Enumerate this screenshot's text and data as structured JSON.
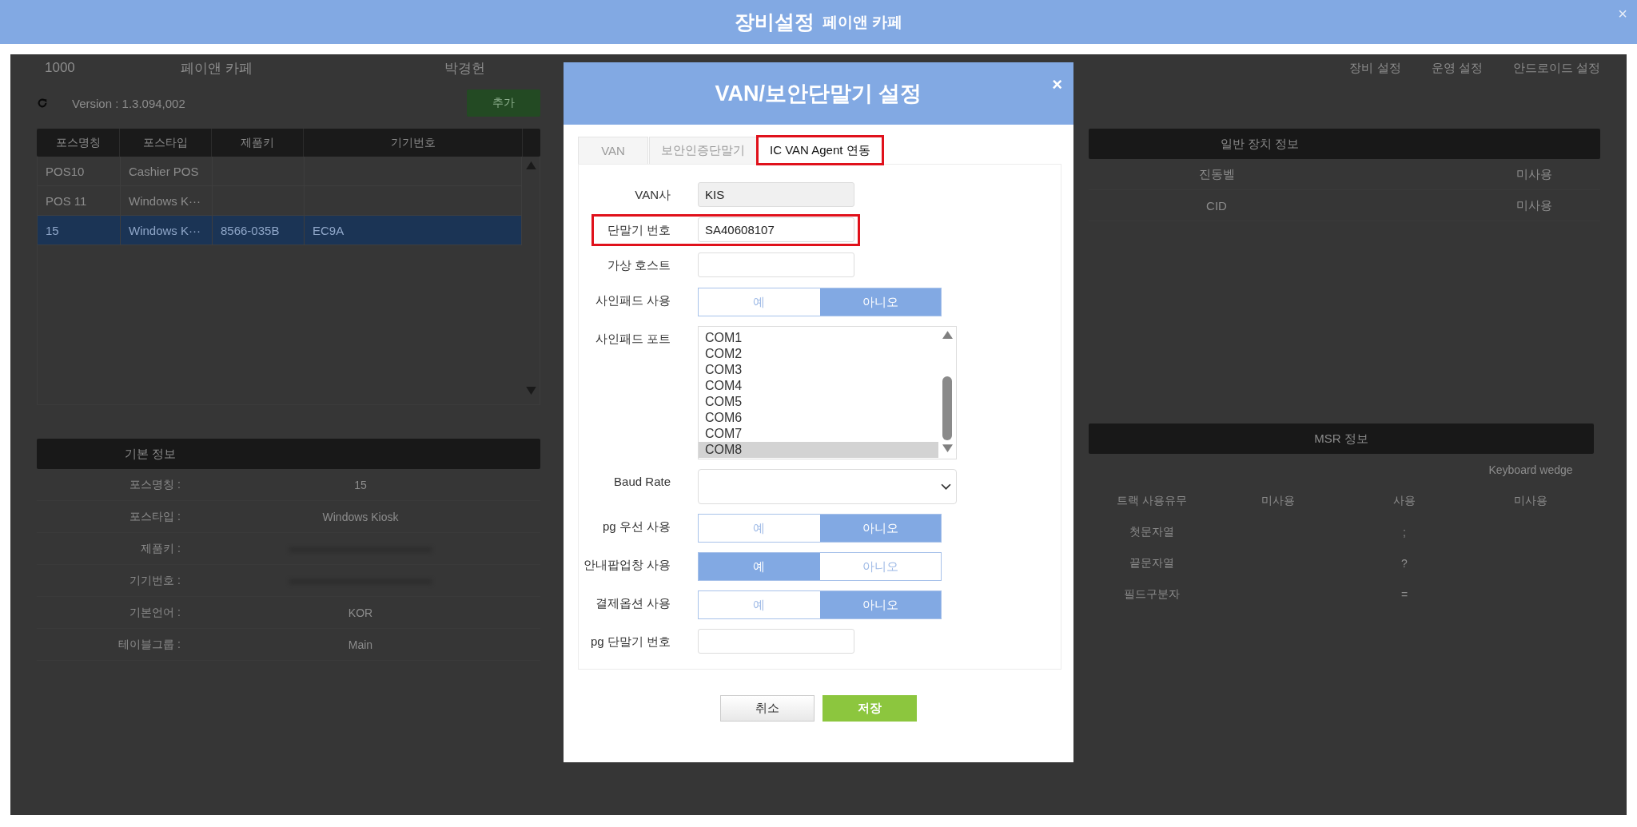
{
  "window": {
    "title": "장비설정",
    "subtitle": "페이앤 카페",
    "close": "×"
  },
  "store_bar": {
    "code": "1000",
    "name": "페이앤 카페",
    "owner": "박경헌",
    "links": [
      "장비 설정",
      "운영 설정",
      "안드로이드 설정"
    ]
  },
  "toolbar": {
    "version": "Version : 1.3.094,002",
    "add_button": "추가"
  },
  "pos_table": {
    "columns": [
      "포스명칭",
      "포스타입",
      "제품키",
      "기기번호"
    ],
    "rows": [
      {
        "cells": [
          "POS10",
          "Cashier POS",
          "",
          ""
        ],
        "selected": false
      },
      {
        "cells": [
          "POS 11",
          "Windows K···",
          "",
          ""
        ],
        "selected": false
      },
      {
        "cells": [
          "15",
          "Windows K···",
          "8566-035B",
          "EC9A"
        ],
        "selected": true
      }
    ]
  },
  "general_devices": {
    "title": "일반 장치 정보",
    "rows": [
      {
        "name": "진동벨",
        "value": "미사용"
      },
      {
        "name": "CID",
        "value": "미사용"
      }
    ]
  },
  "basic_info": {
    "title": "기본 정보",
    "rows": [
      {
        "label": "포스명칭 :",
        "value": "15"
      },
      {
        "label": "포스타입 :",
        "value": "Windows Kiosk"
      },
      {
        "label": "제품키 :",
        "blurred": true
      },
      {
        "label": "기기번호 :",
        "blurred": true
      },
      {
        "label": "기본언어 :",
        "value": "KOR"
      },
      {
        "label": "테이블그룹 :",
        "value": "Main"
      }
    ]
  },
  "msr_info": {
    "title": "MSR 정보",
    "mode": "Keyboard wedge",
    "track_row": [
      "트랙 사용유무",
      "미사용",
      "사용",
      "미사용"
    ],
    "rows": [
      {
        "label": "첫문자열",
        "value": ";"
      },
      {
        "label": "끝문자열",
        "value": "?"
      },
      {
        "label": "필드구분자",
        "value": "="
      }
    ]
  },
  "dialog": {
    "title": "VAN/보안단말기 설정",
    "close": "×",
    "tabs": [
      {
        "label": "VAN",
        "selected": false,
        "highlighted": false
      },
      {
        "label": "보안인증단말기",
        "selected": false,
        "highlighted": false
      },
      {
        "label": "IC VAN Agent 연동",
        "selected": true,
        "highlighted": true
      }
    ],
    "fields": [
      {
        "kind": "readonly",
        "label": "VAN사",
        "value": "KIS",
        "highlighted": false
      },
      {
        "kind": "text",
        "label": "단말기 번호",
        "value": "SA40608107",
        "highlighted": true
      },
      {
        "kind": "text",
        "label": "가상 호스트",
        "highlighted": false
      },
      {
        "kind": "toggle",
        "label": "사인패드 사용",
        "options": [
          {
            "label": "예",
            "selected": false
          },
          {
            "label": "아니오",
            "selected": true
          }
        ]
      },
      {
        "kind": "listbox",
        "label": "사인패드 포트",
        "items": [
          {
            "label": "COM1",
            "selected": false
          },
          {
            "label": "COM2",
            "selected": false
          },
          {
            "label": "COM3",
            "selected": false
          },
          {
            "label": "COM4",
            "selected": false
          },
          {
            "label": "COM5",
            "selected": false
          },
          {
            "label": "COM6",
            "selected": false
          },
          {
            "label": "COM7",
            "selected": false
          },
          {
            "label": "COM8",
            "selected": true
          }
        ]
      },
      {
        "kind": "select",
        "label": "Baud Rate"
      },
      {
        "kind": "toggle",
        "label": "pg 우선 사용",
        "options": [
          {
            "label": "예",
            "selected": false
          },
          {
            "label": "아니오",
            "selected": true
          }
        ]
      },
      {
        "kind": "toggle",
        "label": "안내팝업창 사용",
        "options": [
          {
            "label": "예",
            "selected": true
          },
          {
            "label": "아니오",
            "selected": false
          }
        ]
      },
      {
        "kind": "toggle",
        "label": "결제옵션 사용",
        "options": [
          {
            "label": "예",
            "selected": false
          },
          {
            "label": "아니오",
            "selected": true
          }
        ]
      },
      {
        "kind": "text",
        "label": "pg 단말기 번호",
        "highlighted": false
      }
    ],
    "buttons": {
      "cancel": "취소",
      "save": "저장"
    }
  }
}
